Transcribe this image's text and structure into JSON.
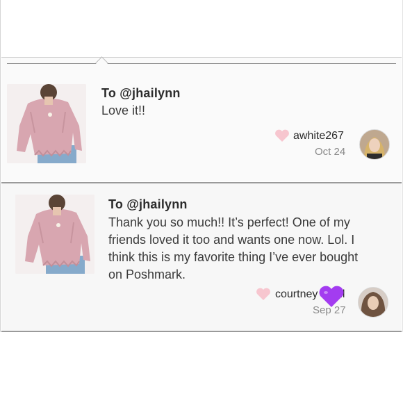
{
  "comments": [
    {
      "to": "To @jhailynn",
      "text": "Love it!!",
      "username": "awhite267",
      "date": "Oct 24"
    },
    {
      "to": "To @jhailynn",
      "text_lines": [
        "Thank you so much!! It’s perfect! One of my",
        "friends loved it too and wants one now. Lol. I",
        "think this is my favorite thing I’ve ever bought",
        "on Poshmark."
      ],
      "username": "courtney  ll",
      "date": "Sep 27"
    }
  ],
  "colors": {
    "heart": "#f7c6cf",
    "emoji_heart": "#a33cf0",
    "sweater": "#d9a9b2",
    "jeans": "#7fa6c9"
  },
  "icons": {
    "like": "heart-icon",
    "overlay": "purple-heart-emoji-icon"
  }
}
